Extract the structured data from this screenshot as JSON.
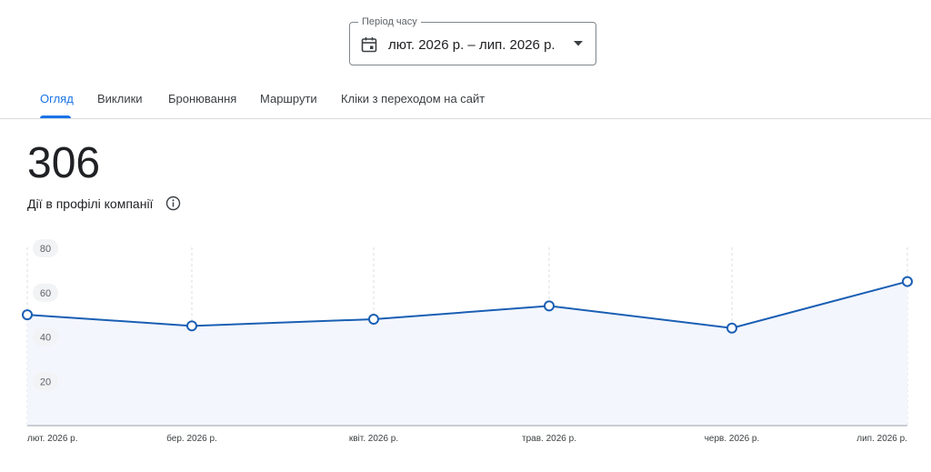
{
  "period": {
    "legend": "Період часу",
    "value": "лют. 2026 р. – лип. 2026 р."
  },
  "tabs": [
    {
      "label": "Огляд",
      "active": true
    },
    {
      "label": "Виклики",
      "active": false
    },
    {
      "label": "Бронювання",
      "active": false
    },
    {
      "label": "Маршрути",
      "active": false
    },
    {
      "label": "Кліки з переходом на сайт",
      "active": false
    }
  ],
  "summary": {
    "total": "306",
    "label": "Дії в профілі компанії"
  },
  "icons": {
    "period": "calendar-icon",
    "dropdown": "caret-down-icon",
    "info": "info-icon"
  },
  "colors": {
    "accent": "#1a73e8",
    "line": "#1a5fb4",
    "area": "#f3f6fd"
  },
  "chart_data": {
    "type": "area",
    "title": "",
    "xlabel": "",
    "ylabel": "",
    "categories": [
      "лют. 2026 р.",
      "бер. 2026 р.",
      "квіт. 2026 р.",
      "трав. 2026 р.",
      "черв. 2026 р.",
      "лип. 2026 р."
    ],
    "series": [
      {
        "values": [
          50,
          45,
          48,
          54,
          44,
          65
        ]
      }
    ],
    "yticks": [
      20,
      40,
      60,
      80
    ],
    "ylim": [
      0,
      80
    ],
    "grid": true,
    "markers": "hollow-circle"
  }
}
